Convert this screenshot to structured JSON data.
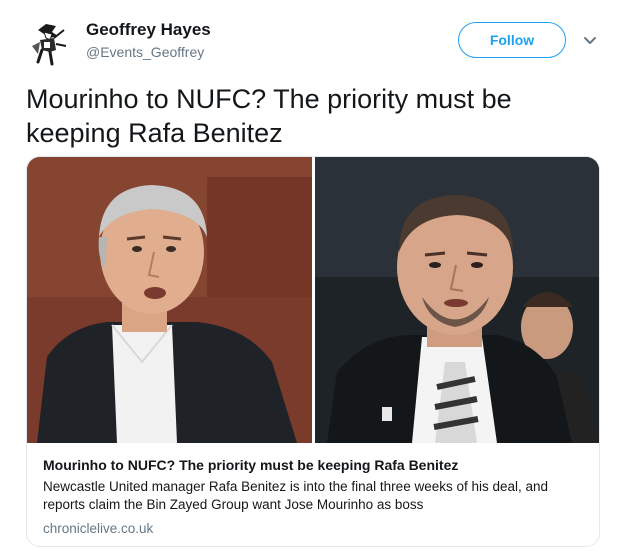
{
  "tweet": {
    "author": {
      "name": "Geoffrey Hayes",
      "handle": "@Events_Geoffrey",
      "avatar_icon": "magpie-knight-icon"
    },
    "follow_label": "Follow",
    "menu_icon": "chevron-down-icon",
    "text": "Mourinho to NUFC? The priority must be keeping Rafa Benitez"
  },
  "card": {
    "images": [
      "man-speaking-portrait",
      "man-in-suit-portrait"
    ],
    "title": "Mourinho to NUFC? The priority must be keeping Rafa Benitez",
    "description": "Newcastle United manager Rafa Benitez is into the final three weeks of his deal, and reports claim the Bin Zayed Group want Jose Mourinho as boss",
    "domain": "chroniclelive.co.uk"
  },
  "colors": {
    "accent": "#1da1f2",
    "text": "#14171a",
    "muted": "#657786",
    "border": "#e1e8ed"
  }
}
